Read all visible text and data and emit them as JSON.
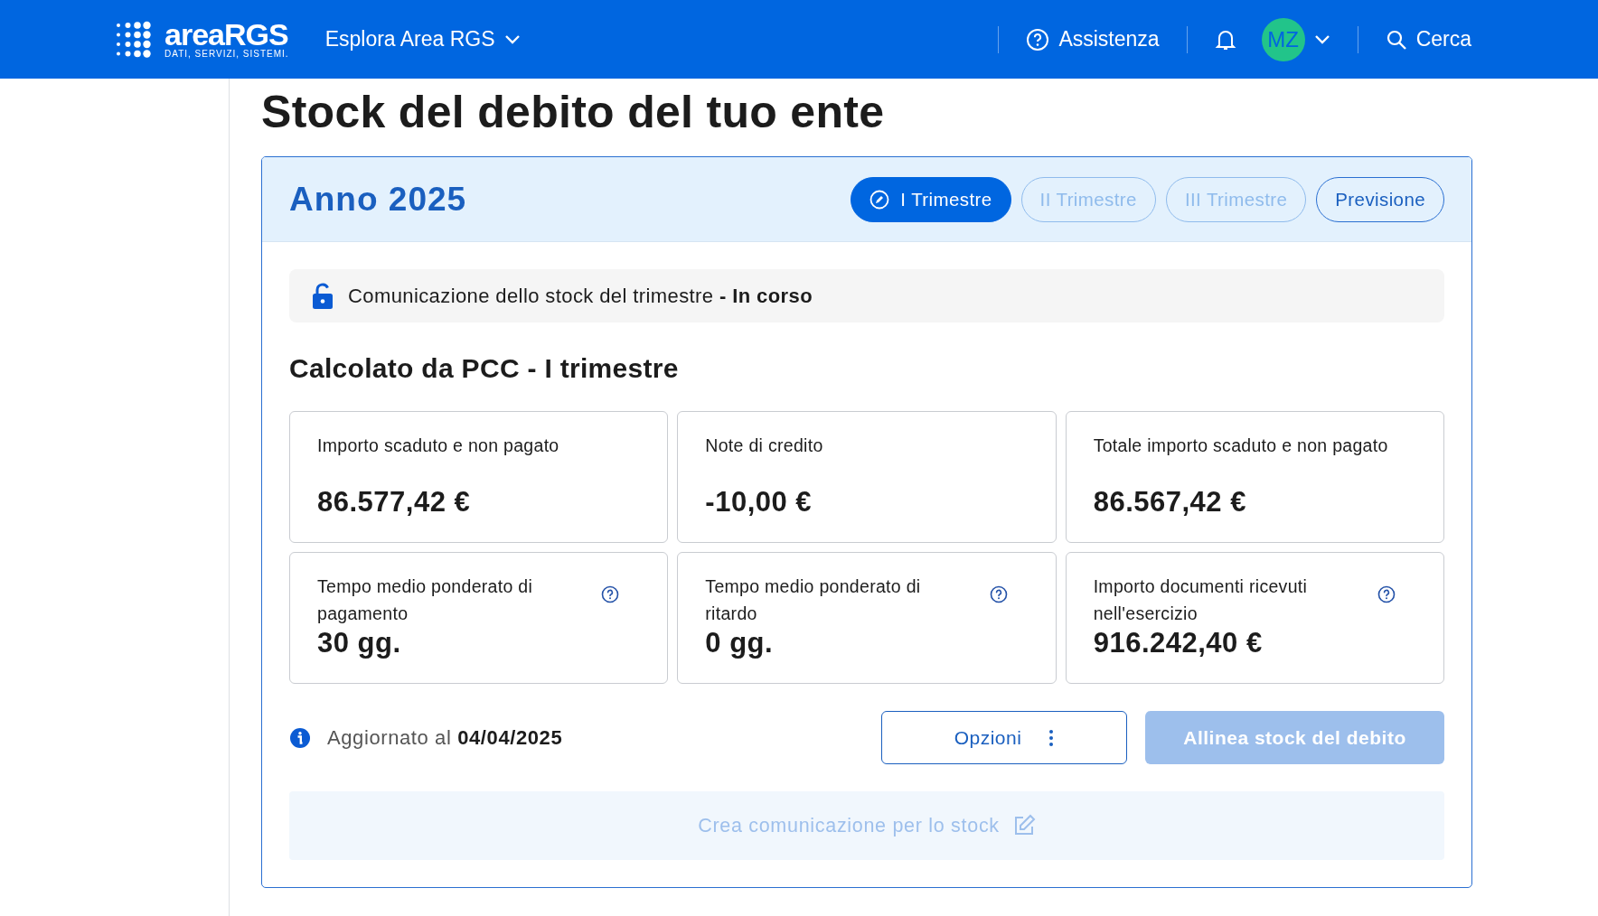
{
  "header": {
    "brand": "areaRGS",
    "tagline": "DATI, SERVIZI, SISTEMI.",
    "nav_menu": "Esplora Area RGS",
    "help": "Assistenza",
    "avatar": "MZ",
    "search": "Cerca"
  },
  "page_title": "Stock del debito del tuo ente",
  "year_panel": {
    "title": "Anno 2025",
    "tabs": [
      {
        "label": "I Trimestre",
        "selected": true,
        "disabled": false
      },
      {
        "label": "II Trimestre",
        "selected": false,
        "disabled": true
      },
      {
        "label": "III Trimestre",
        "selected": false,
        "disabled": true
      },
      {
        "label": "Previsione",
        "selected": false,
        "disabled": false
      }
    ],
    "status_banner": "Comunicazione dello stock del trimestre **- In corso**",
    "section_title": "Calcolato da PCC - I trimestre",
    "stats": [
      {
        "label": "Importo scaduto e non pagato",
        "value": "86.577,42 €",
        "help": false
      },
      {
        "label": "Note di credito",
        "value": "-10,00 €",
        "help": false
      },
      {
        "label": "Totale importo scaduto e non pagato",
        "value": "86.567,42 €",
        "help": false
      },
      {
        "label": "Tempo medio ponderato di pagamento",
        "value": "30 gg.",
        "help": true
      },
      {
        "label": "Tempo medio ponderato di ritardo",
        "value": "0 gg.",
        "help": true
      },
      {
        "label": "Importo documenti ricevuti nell'esercizio",
        "value": "916.242,40 €",
        "help": true
      }
    ],
    "updated": "Aggiornato al **04/04/2025**",
    "options_button": "Opzioni",
    "align_button": {
      "label": "Allinea stock del debito",
      "disabled": true
    },
    "create_button": {
      "label": "Crea comunicazione per lo stock",
      "disabled": true
    }
  }
}
